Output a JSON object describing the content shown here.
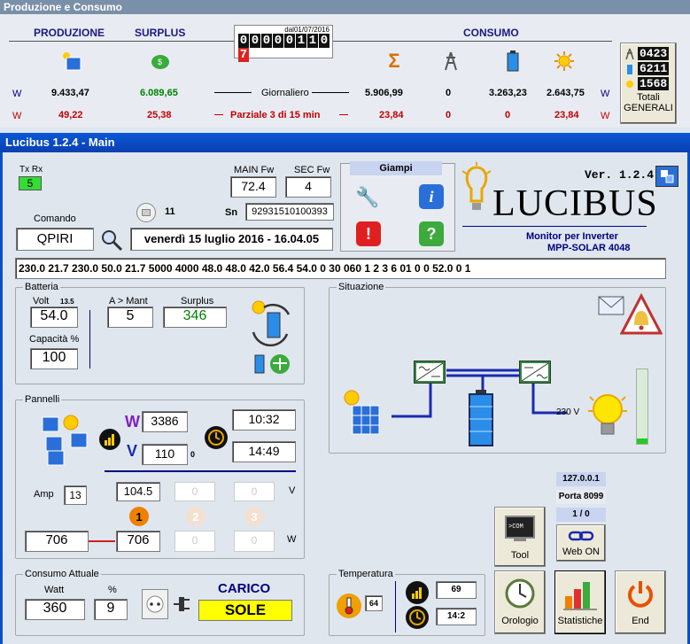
{
  "top": {
    "title": "Produzione e Consumo",
    "prod_label": "PRODUZIONE",
    "surplus_label": "SURPLUS",
    "consumo_label": "CONSUMO",
    "date_since": "dal01/07/2016",
    "counter": [
      "0",
      "0",
      "0",
      "0",
      "0",
      "1",
      "1",
      "0",
      "7"
    ],
    "unit_w": "W",
    "row1": {
      "prod": "9.433,47",
      "surplus": "6.089,65",
      "label": "Giornaliero",
      "c1": "5.906,99",
      "c2": "0",
      "c3": "3.263,23",
      "c4": "2.643,75"
    },
    "row2": {
      "prod": "49,22",
      "surplus": "25,38",
      "label": "Parziale 3 di 15 min",
      "c1": "23,84",
      "c2": "0",
      "c3": "0",
      "c4": "23,84"
    },
    "totals": {
      "t1": "0423",
      "t2": "6211",
      "t3": "1568",
      "label1": "Totali",
      "label2": "GENERALI"
    }
  },
  "main": {
    "title": "Lucibus 1.2.4 - Main",
    "txrx_label": "Tx Rx",
    "txrx_value": "5",
    "main_fw_label": "MAIN Fw",
    "main_fw": "72.4",
    "sec_fw_label": "SEC Fw",
    "sec_fw": "4",
    "sn_label": "Sn",
    "sn": "92931510100393",
    "user": "Giampi",
    "version": "Ver. 1.2.4",
    "logo_text": "LUCIBUS",
    "subtitle1": "Monitor per Inverter",
    "subtitle2": "MPP-SOLAR 4048",
    "comando_label": "Comando",
    "comando": "QPIRI",
    "count": "11",
    "datetime": "venerdì 15 luglio 2016 - 16.04.05",
    "response": "230.0 21.7 230.0 50.0 21.7 5000 4000 48.0 48.0 42.0 56.4 54.0 0 30 060 1 2 3 6 01 0 0 52.0 0 1"
  },
  "batteria": {
    "title": "Batteria",
    "volt_label": "Volt",
    "volt_small": "13.5",
    "volt": "54.0",
    "cap_label": "Capacità %",
    "cap": "100",
    "amant_label": "A > Mant",
    "amant": "5",
    "surplus_label": "Surplus",
    "surplus": "346"
  },
  "situazione": {
    "title": "Situazione",
    "voltage": "230 V",
    "level": 0.07
  },
  "pannelli": {
    "title": "Pannelli",
    "w_label": "W",
    "w": "3386",
    "v_label": "V",
    "v": "110",
    "small0": "0",
    "time1": "10:32",
    "time2": "14:49",
    "amp_label": "Amp",
    "amp": "13",
    "v1": "104.5",
    "v2": "0",
    "v3": "0",
    "v_unit": "V",
    "n1": "1",
    "n2": "2",
    "n3": "3",
    "w_in": "706",
    "w1": "706",
    "w2": "0",
    "w3": "0",
    "w_unit": "W"
  },
  "consumo": {
    "title": "Consumo Attuale",
    "watt_label": "Watt",
    "pct_label": "%",
    "watt": "360",
    "pct": "9",
    "carico_label": "CARICO",
    "carico": "SOLE"
  },
  "temperatura": {
    "title": "Temperatura",
    "temp": "64",
    "val1": "69",
    "val2": "14:2"
  },
  "network": {
    "ip": "127.0.0.1",
    "porta": "Porta 8099",
    "ratio": "1 / 0",
    "webon": "Web ON"
  },
  "buttons": {
    "tool": "Tool",
    "orologio": "Orologio",
    "statistiche": "Statistiche",
    "end": "End"
  },
  "colors": {
    "titlebar": "#0a4fc8",
    "surplus_green": "#008000",
    "red": "#c00000",
    "carico_yellow": "#ffff00"
  }
}
